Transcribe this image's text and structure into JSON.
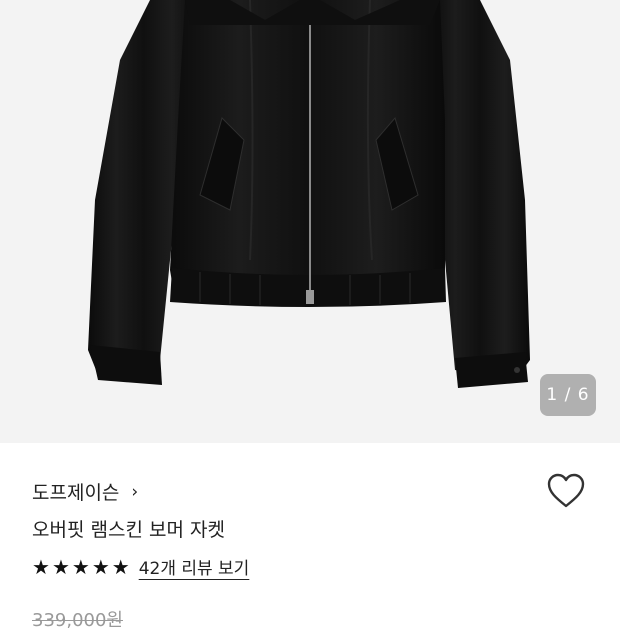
{
  "gallery": {
    "counter": "1 / 6",
    "image_alt": "black leather bomber jacket"
  },
  "product": {
    "brand": "도프제이슨",
    "brand_chevron": "›",
    "title": "오버핏 램스킨 보머 자켓",
    "rating_stars": 5,
    "review_link": "42개 리뷰 보기",
    "original_price": "339,000원"
  },
  "icons": {
    "heart": "heart-outline-icon",
    "star": "star-filled-icon",
    "chevron": "chevron-right-icon"
  },
  "colors": {
    "background_image": "#f3f3f3",
    "jacket": "#141414",
    "text": "#222222",
    "muted": "#999999"
  }
}
